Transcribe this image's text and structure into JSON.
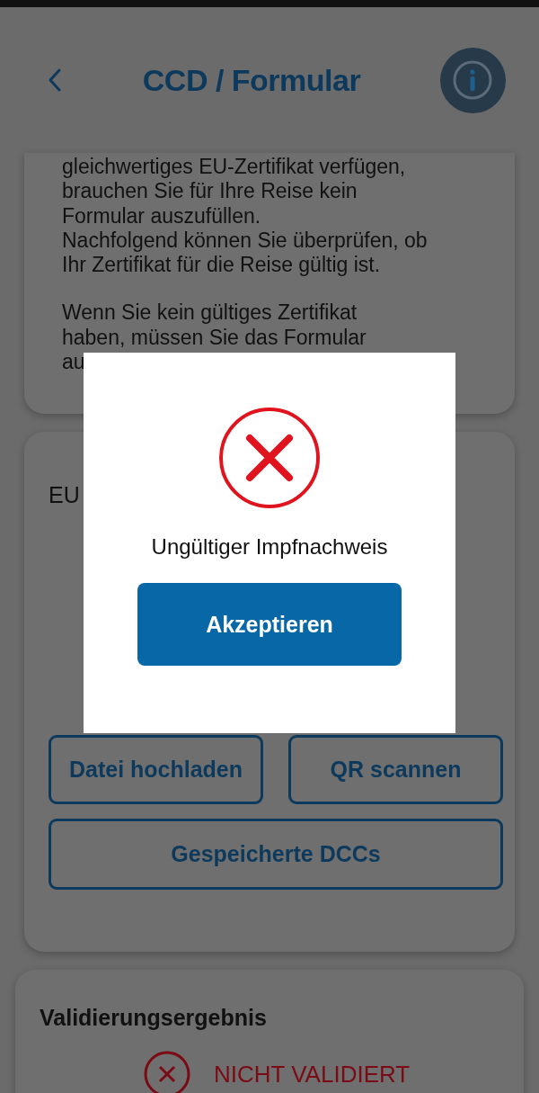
{
  "header": {
    "title": "CCD / Formular"
  },
  "intro_card": {
    "paragraphs": [
      "gleichwertiges EU-Zertifikat verfügen,\nbrauchen Sie für Ihre Reise kein\nFormular auszufüllen.\nNachfolgend können Sie überprüfen, ob\nIhr Zertifikat für die Reise gültig ist.",
      "Wenn Sie kein gültiges Zertifikat\nhaben, müssen Sie das Formular\nau"
    ]
  },
  "certificate_card": {
    "title": "EU",
    "buttons": [
      "Datei hochladen",
      "QR scannen",
      "Gespeicherte DCCs"
    ]
  },
  "result_card": {
    "title": "Validierungsergebnis",
    "status": {
      "kind": "invalid",
      "label": "NICHT VALIDIERT"
    }
  },
  "dialog": {
    "kind": "error",
    "message": "Ungültiger Impfnachweis",
    "button": "Akzeptieren"
  }
}
